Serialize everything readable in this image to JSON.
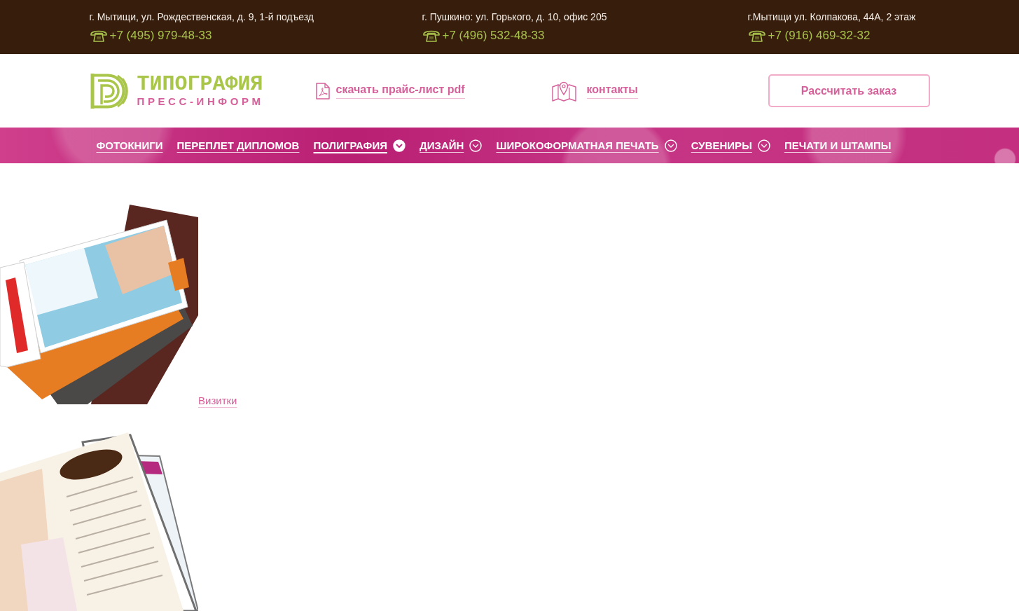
{
  "top_bar": {
    "offices": [
      {
        "address": "г. Мытищи, ул. Рождественская, д. 9, 1-й подъезд",
        "phone": "+7 (495) 979-48-33"
      },
      {
        "address": "г. Пушкино: ул. Горького, д. 10, офис 205",
        "phone": "+7 (496) 532-48-33"
      },
      {
        "address": "г.Мытищи ул. Колпакова, 44А, 2 этаж",
        "phone": "+7 (916) 469-32-32"
      }
    ]
  },
  "header": {
    "logo": {
      "title": "ТИПОГРАФИЯ",
      "subtitle": "ПРЕСС-ИНФОРМ"
    },
    "price_list_link": "скачать прайс-лист pdf",
    "contacts_link": "контакты",
    "order_button": "Рассчитать заказ"
  },
  "nav": {
    "items": [
      {
        "label": "ФОТОКНИГИ",
        "selected": false,
        "dropdown": false
      },
      {
        "label": "ПЕРЕПЛЕТ ДИПЛОМОВ",
        "selected": false,
        "dropdown": false
      },
      {
        "label": "ПОЛИГРАФИЯ",
        "selected": true,
        "dropdown": true
      },
      {
        "label": "ДИЗАЙН",
        "selected": false,
        "dropdown": true
      },
      {
        "label": "ШИРОКОФОРМАТНАЯ ПЕЧАТЬ",
        "selected": false,
        "dropdown": true
      },
      {
        "label": "СУВЕНИРЫ",
        "selected": false,
        "dropdown": true
      },
      {
        "label": "ПЕЧАТИ И ШТАМПЫ",
        "selected": false,
        "dropdown": false
      }
    ]
  },
  "products": [
    {
      "kind": "business_cards",
      "link": "Визитки"
    },
    {
      "kind": "brochures"
    }
  ]
}
